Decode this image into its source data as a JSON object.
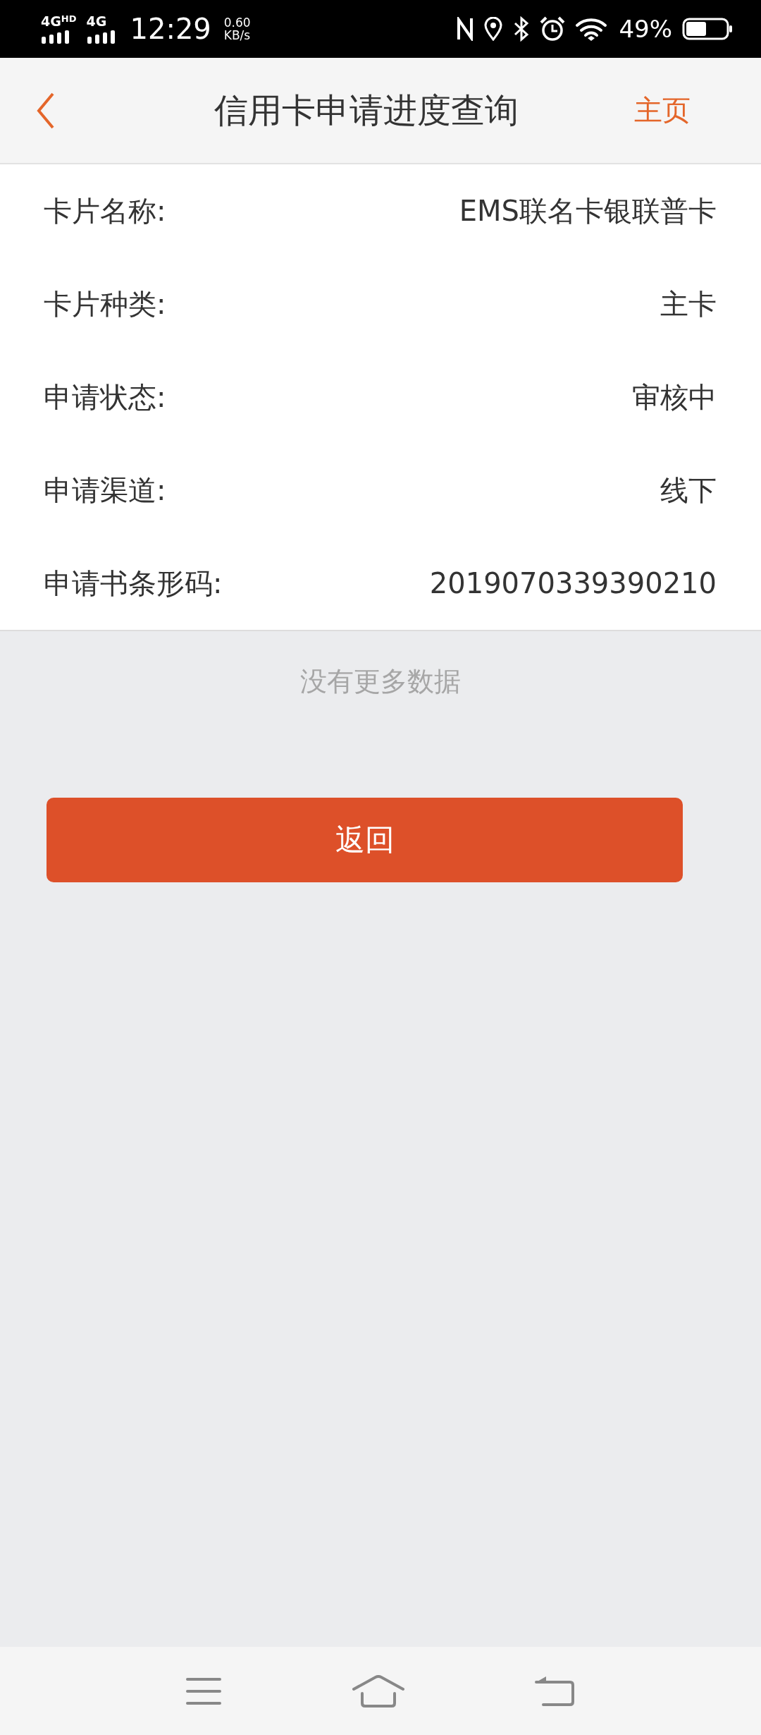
{
  "status_bar": {
    "network_1": "4G",
    "network_1_badge": "HD",
    "network_2": "4G",
    "time": "12:29",
    "speed_value": "0.60",
    "speed_unit": "KB/s",
    "battery": "49%"
  },
  "header": {
    "title": "信用卡申请进度查询",
    "home": "主页"
  },
  "details": [
    {
      "label": "卡片名称:",
      "value": "EMS联名卡银联普卡"
    },
    {
      "label": "卡片种类:",
      "value": "主卡"
    },
    {
      "label": "申请状态:",
      "value": "审核中"
    },
    {
      "label": "申请渠道:",
      "value": "线下"
    },
    {
      "label": "申请书条形码:",
      "value": "2019070339390210"
    }
  ],
  "footer_note": "没有更多数据",
  "return_button": "返回"
}
